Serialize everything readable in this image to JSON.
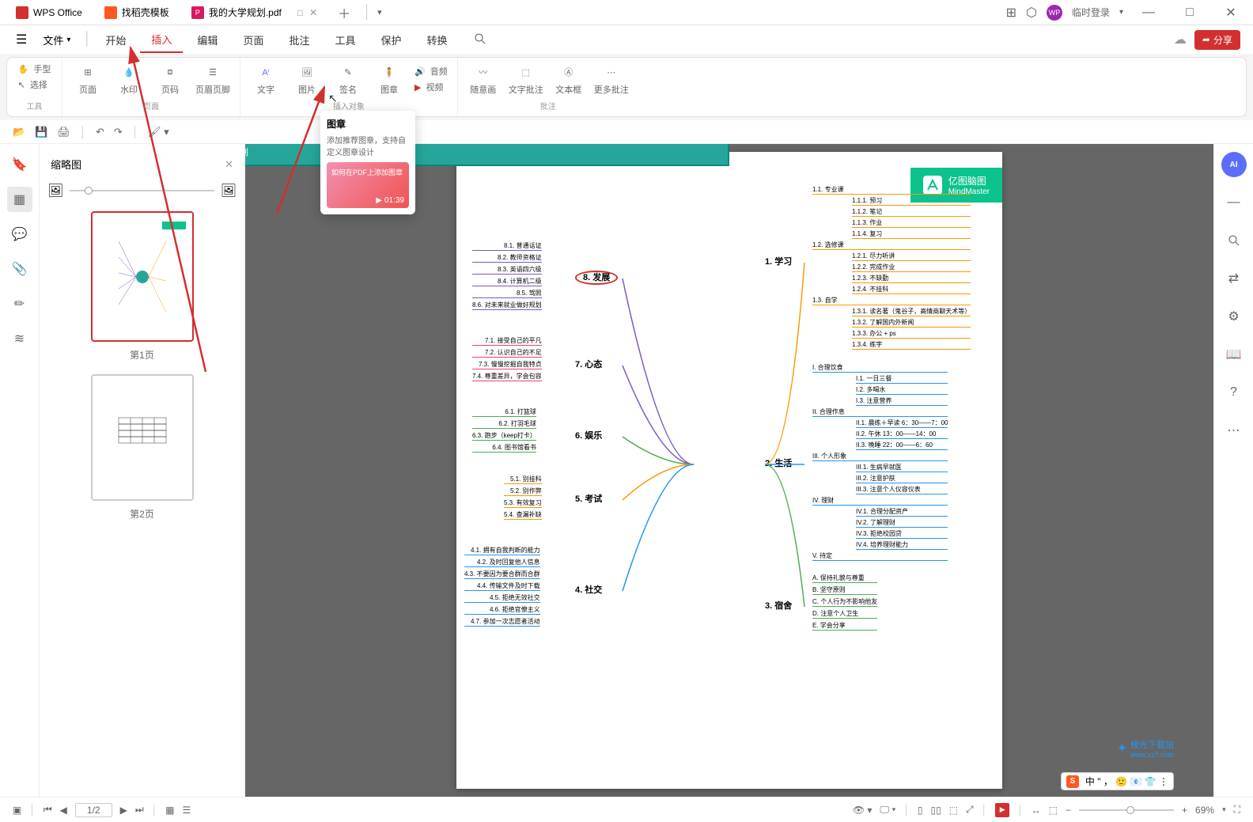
{
  "titlebar": {
    "tabs": [
      {
        "icon": "wps",
        "label": "WPS Office"
      },
      {
        "icon": "docer",
        "label": "找稻壳模板"
      },
      {
        "icon": "pdf",
        "label": "我的大学规划.pdf",
        "active": true
      }
    ],
    "login": "临时登录"
  },
  "menubar": {
    "file": "文件",
    "items": [
      "开始",
      "插入",
      "编辑",
      "页面",
      "批注",
      "工具",
      "保护",
      "转换"
    ],
    "active_index": 1,
    "share": "分享"
  },
  "ribbon": {
    "group1": {
      "hand": "手型",
      "select": "选择",
      "label": "工具"
    },
    "group2": {
      "tools": [
        {
          "name": "blank-page",
          "label": "页面"
        },
        {
          "name": "watermark",
          "label": "水印"
        },
        {
          "name": "page-number",
          "label": "页码"
        },
        {
          "name": "header-footer",
          "label": "页眉页脚"
        }
      ],
      "label": "页面"
    },
    "group3": {
      "tools": [
        {
          "name": "text",
          "label": "文字"
        },
        {
          "name": "picture",
          "label": "图片"
        },
        {
          "name": "signature",
          "label": "签名"
        },
        {
          "name": "stamp",
          "label": "图章"
        },
        {
          "name": "audio",
          "label": "音频"
        },
        {
          "name": "video",
          "label": "视频"
        }
      ],
      "label": "插入对象"
    },
    "group4": {
      "tools": [
        {
          "name": "freehand",
          "label": "随意画"
        },
        {
          "name": "text-annot",
          "label": "文字批注"
        },
        {
          "name": "textbox",
          "label": "文本框"
        },
        {
          "name": "more-annot",
          "label": "更多批注"
        }
      ],
      "label": "批注"
    }
  },
  "tooltip": {
    "title": "图章",
    "desc": "添加推荐图章，支持自定义图章设计",
    "video_title": "如何在PDF上添加图章",
    "video_time": "01:39"
  },
  "thumbnail": {
    "title": "缩略图",
    "pages": [
      "第1页",
      "第2页"
    ]
  },
  "statusbar": {
    "page": "1/2",
    "zoom": "69%",
    "nav": {
      "first": "⏮",
      "prev": "◀",
      "next": "▶",
      "last": "⏭"
    }
  },
  "mindmap": {
    "brand_cn": "亿图脑图",
    "brand_en": "MindMaster",
    "center": "我的大学规划",
    "left": {
      "t8": {
        "title": "8. 发展",
        "items": [
          "8.1. 普通话证",
          "8.2. 教师资格证",
          "8.3. 英语四六级",
          "8.4. 计算机二级",
          "8.5. 驾照",
          "8.6. 对未来就业做好规划"
        ]
      },
      "t7": {
        "title": "7. 心态",
        "items": [
          "7.1. 接受自己的平凡",
          "7.2. 认识自己的不足",
          "7.3. 慢慢挖掘自我特点",
          "7.4. 尊重差异，学会包容"
        ]
      },
      "t6": {
        "title": "6. 娱乐",
        "items": [
          "6.1. 打篮球",
          "6.2. 打羽毛球",
          "6.3. 跑步（keep打卡）",
          "6.4. 图书馆看书"
        ]
      },
      "t5": {
        "title": "5. 考试",
        "items": [
          "5.1. 别挂科",
          "5.2. 别作弊",
          "5.3. 有效复习",
          "5.4. 查漏补缺"
        ]
      },
      "t4": {
        "title": "4. 社交",
        "items": [
          "4.1. 拥有自我判断的能力",
          "4.2. 及时回复他人信息",
          "4.3. 不要因为要合群而合群",
          "4.4. 传输文件及时下载",
          "4.5. 拒绝无效社交",
          "4.6. 拒绝官僚主义",
          "4.7. 参加一次志愿者活动"
        ]
      }
    },
    "right": {
      "t1": {
        "title": "1. 学习",
        "subs": [
          {
            "name": "1.1. 专业课",
            "items": [
              "1.1.1. 预习",
              "1.1.2. 笔记",
              "1.1.3. 作业",
              "1.1.4. 复习"
            ]
          },
          {
            "name": "1.2. 选修课",
            "items": [
              "1.2.1. 尽力听讲",
              "1.2.2. 完成作业",
              "1.2.3. 不缺勤",
              "1.2.4. 不挂科"
            ]
          },
          {
            "name": "1.3. 自学",
            "items": [
              "1.3.1. 读名著（鬼谷子，高情商聊天术等）",
              "1.3.2. 了解国内外新闻",
              "1.3.3. 办公 + ps",
              "1.3.4. 练字"
            ]
          }
        ]
      },
      "t2": {
        "title": "2. 生活",
        "subs": [
          {
            "name": "I. 合理饮食",
            "items": [
              "I.1. 一日三餐",
              "I.2. 多喝水",
              "I.3. 注意营养"
            ]
          },
          {
            "name": "II. 合理作息",
            "items": [
              "II.1. 晨练＋早读 6：30——7：00",
              "II.2. 午休   13：00——14：00",
              "II.3. 晚睡   22：00——6：60"
            ]
          },
          {
            "name": "III. 个人形象",
            "items": [
              "III.1. 生病早就医",
              "III.2. 注意护肤",
              "III.3. 注意个人仪容仪表"
            ]
          },
          {
            "name": "IV. 理财",
            "items": [
              "IV.1. 合理分配资产",
              "IV.2. 了解理财",
              "IV.3. 拒绝校园贷",
              "IV.4. 培养理财能力"
            ]
          },
          {
            "name": "V. 待定",
            "items": []
          }
        ]
      },
      "t3": {
        "title": "3. 宿舍",
        "items": [
          "A. 保持礼貌与尊重",
          "B. 坚守原则",
          "C. 个人行为不影响他友",
          "D. 注意个人卫生",
          "E. 学会分享"
        ]
      }
    }
  },
  "ime": {
    "chars": "中 \"  ， 🙂 📧 👕 ⋮"
  },
  "watermark": {
    "text": "极光下载站",
    "url": "www.xz7.com"
  }
}
